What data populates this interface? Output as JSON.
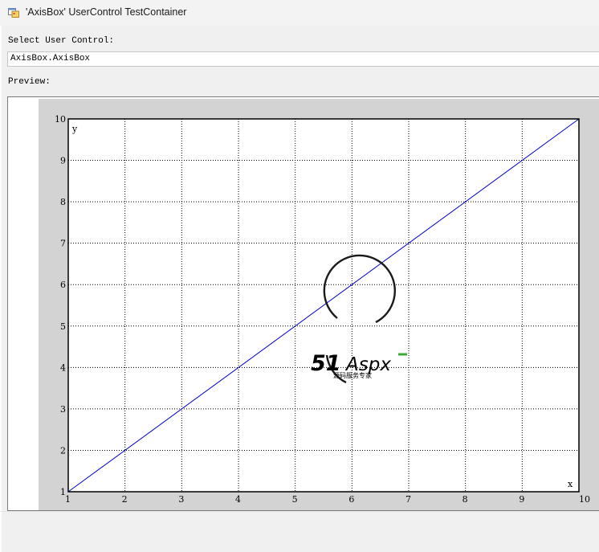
{
  "window": {
    "title": "'AxisBox' UserControl TestContainer",
    "icon": "form-icon"
  },
  "select_label": "Select User Control:",
  "select": {
    "value": "AxisBox.AxisBox"
  },
  "preview_label": "Preview:",
  "chart_data": {
    "type": "line",
    "title": "",
    "xlabel": "x",
    "ylabel": "y",
    "xlim": [
      1,
      10
    ],
    "ylim": [
      1,
      10
    ],
    "x_ticks": [
      "1",
      "2",
      "3",
      "4",
      "5",
      "6",
      "7",
      "8",
      "9",
      "10"
    ],
    "y_ticks": [
      "1",
      "2",
      "3",
      "4",
      "5",
      "6",
      "7",
      "8",
      "9",
      "10"
    ],
    "grid": true,
    "grid_style": "dotted",
    "background": "#ffffff",
    "series": [
      {
        "color": "#0000cc",
        "x": [
          1,
          10
        ],
        "y": [
          1,
          10
        ]
      }
    ]
  },
  "watermark": {
    "brand": "51Aspx",
    "tagline": "源码服务专家",
    "colors": {
      "red": "#e0141e",
      "green": "#3aa935",
      "dark": "#1a1a1a"
    }
  }
}
